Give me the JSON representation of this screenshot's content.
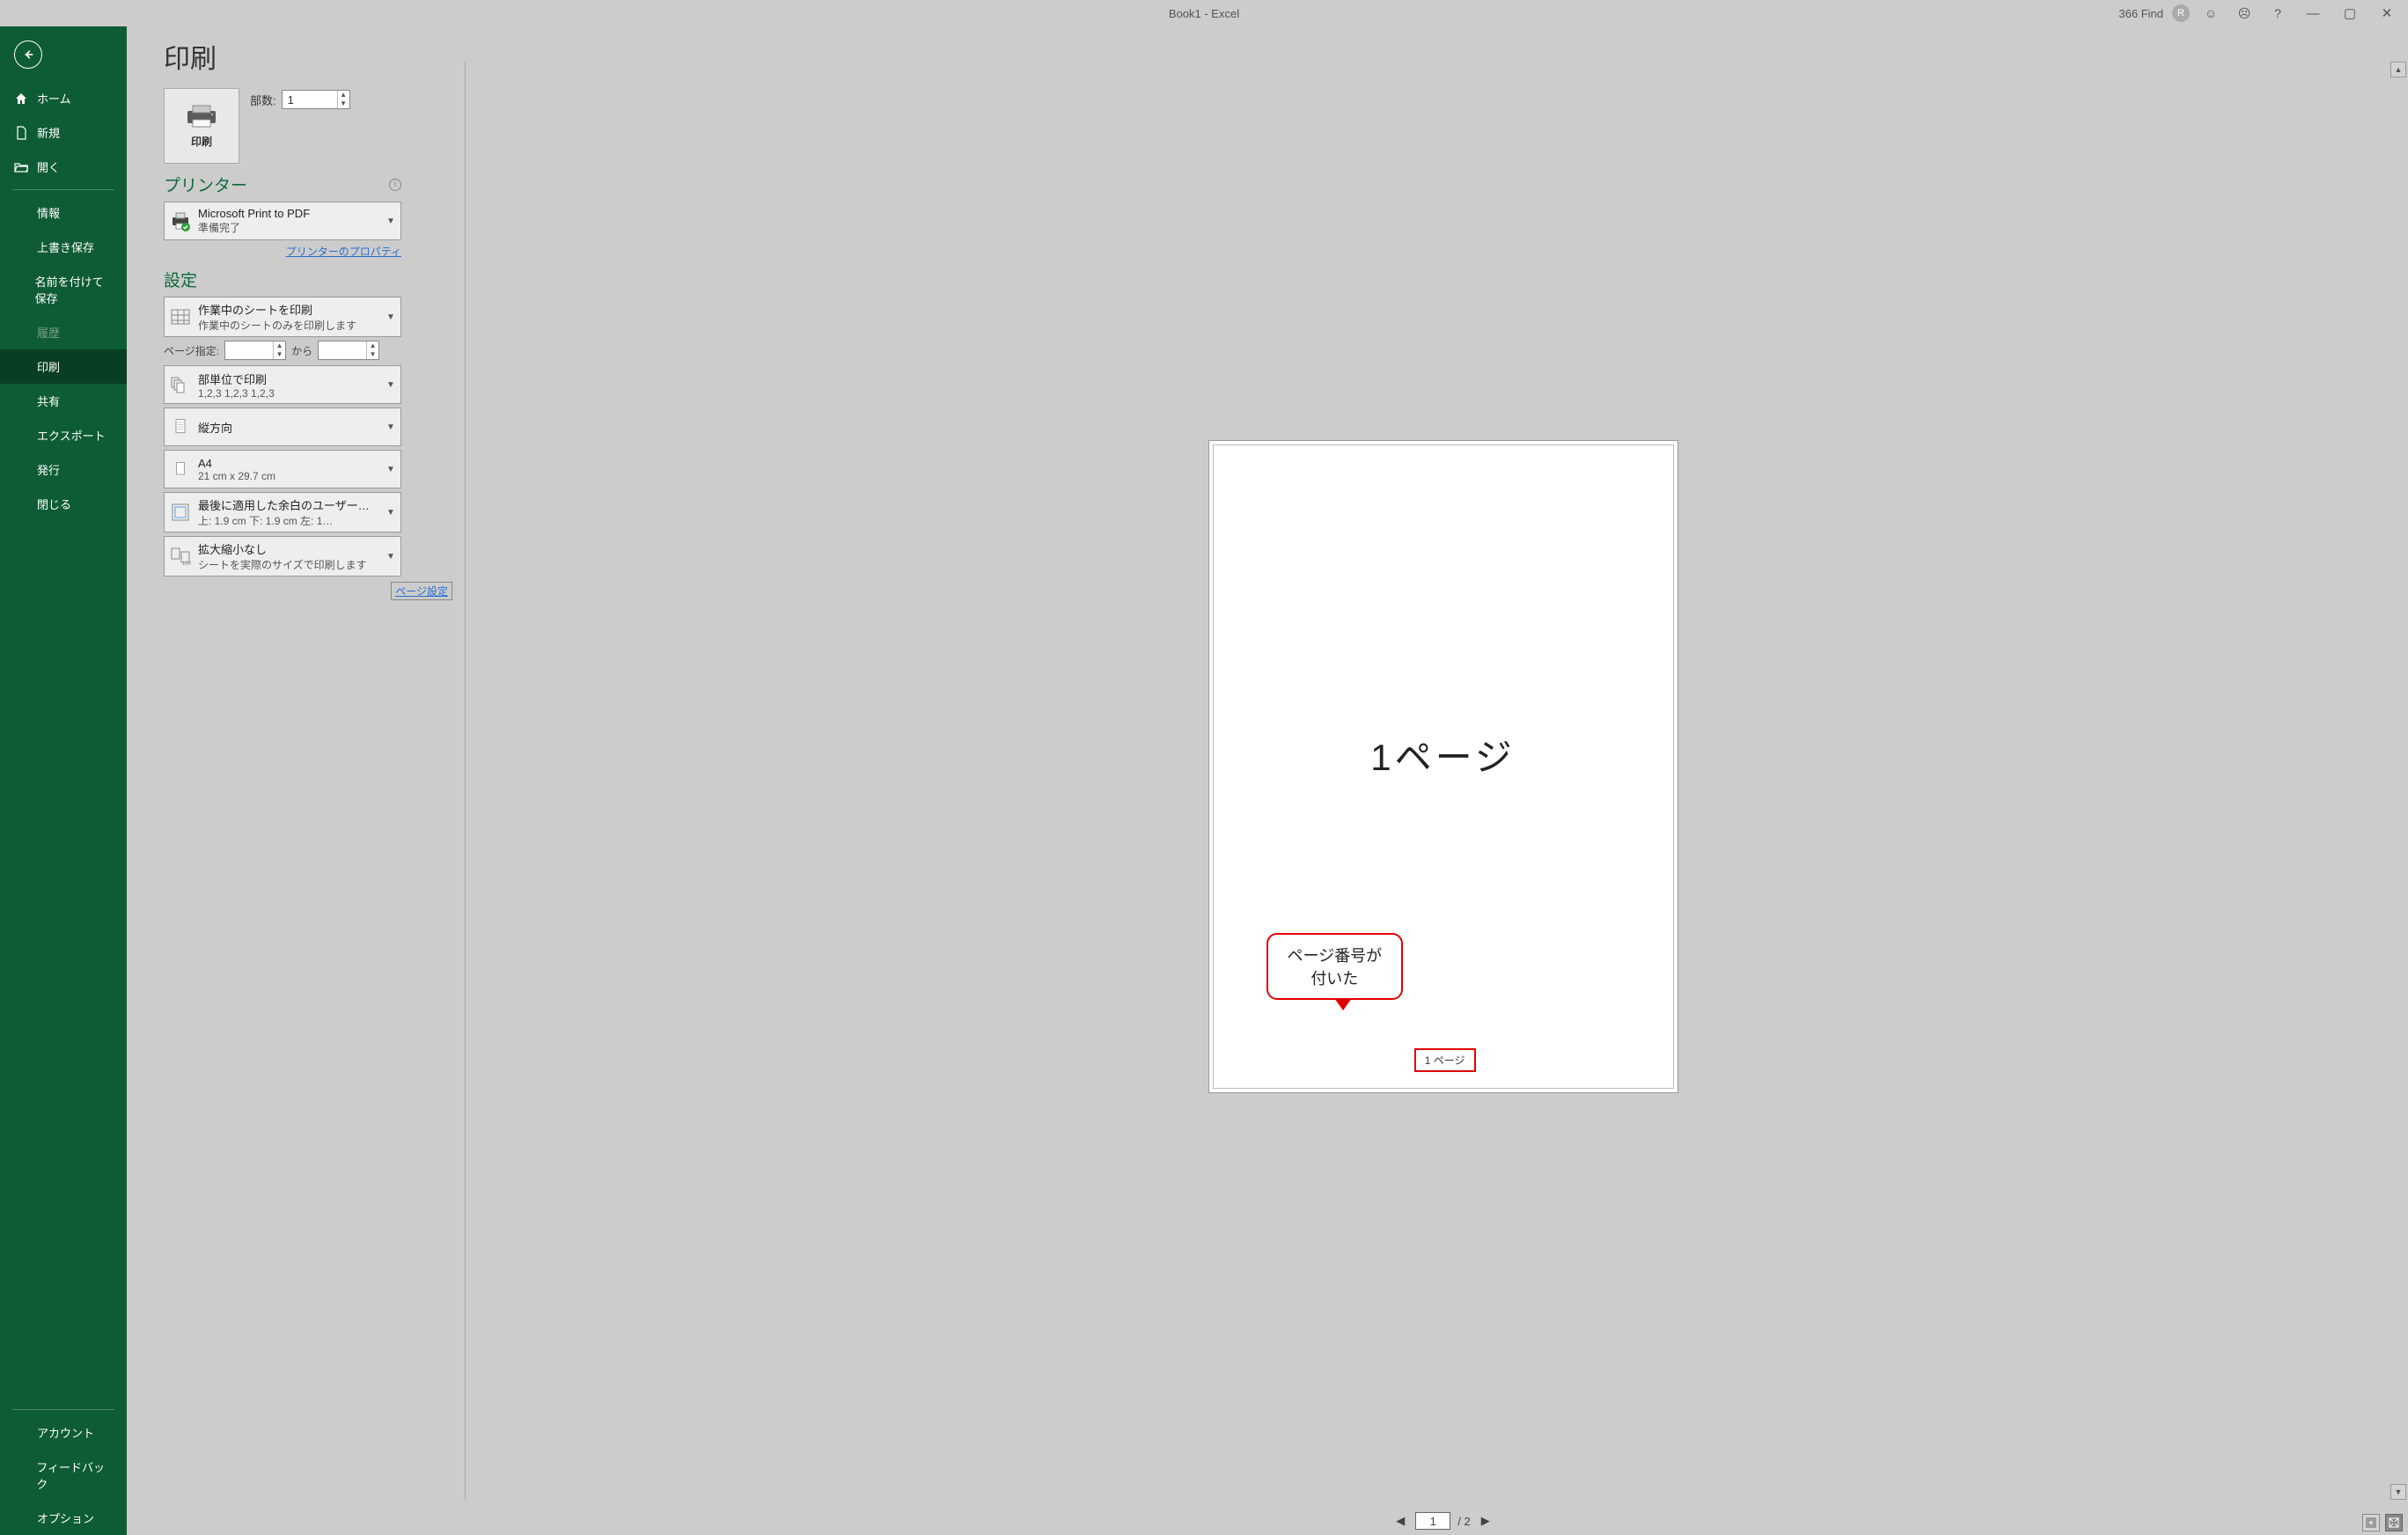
{
  "titlebar": {
    "title": "Book1  -  Excel",
    "user": "366 Find",
    "user_initial": "R"
  },
  "sidebar": {
    "items": [
      {
        "label": "ホーム"
      },
      {
        "label": "新規"
      },
      {
        "label": "開く"
      },
      {
        "label": "情報"
      },
      {
        "label": "上書き保存"
      },
      {
        "label": "名前を付けて保存"
      },
      {
        "label": "履歴"
      },
      {
        "label": "印刷"
      },
      {
        "label": "共有"
      },
      {
        "label": "エクスポート"
      },
      {
        "label": "発行"
      },
      {
        "label": "閉じる"
      },
      {
        "label": "アカウント"
      },
      {
        "label": "フィードバック"
      },
      {
        "label": "オプション"
      }
    ]
  },
  "print": {
    "page_title": "印刷",
    "button_label": "印刷",
    "copies_label": "部数:",
    "copies_value": "1",
    "printer_heading": "プリンター",
    "printer_name": "Microsoft Print to PDF",
    "printer_status": "準備完了",
    "printer_props": "プリンターのプロパティ",
    "settings_heading": "設定",
    "settings": {
      "print_what_title": "作業中のシートを印刷",
      "print_what_sub": "作業中のシートのみを印刷します",
      "page_range_label": "ページ指定:",
      "page_range_from": "",
      "page_range_to_label": "から",
      "page_range_to": "",
      "collate_title": "部単位で印刷",
      "collate_sub": "1,2,3    1,2,3    1,2,3",
      "orientation_title": "縦方向",
      "paper_title": "A4",
      "paper_sub": "21 cm x 29.7 cm",
      "margins_title": "最後に適用した余白のユーザー設定",
      "margins_sub": "上: 1.9 cm 下: 1.9 cm 左: 1…",
      "scale_title": "拡大縮小なし",
      "scale_sub": "シートを実際のサイズで印刷します",
      "page_setup_link": "ページ設定"
    }
  },
  "preview": {
    "big_text": "1ページ",
    "callout_line1": "ページ番号が",
    "callout_line2": "付いた",
    "footer_badge": "1 ページ",
    "pager_current": "1",
    "pager_total": "/ 2"
  }
}
